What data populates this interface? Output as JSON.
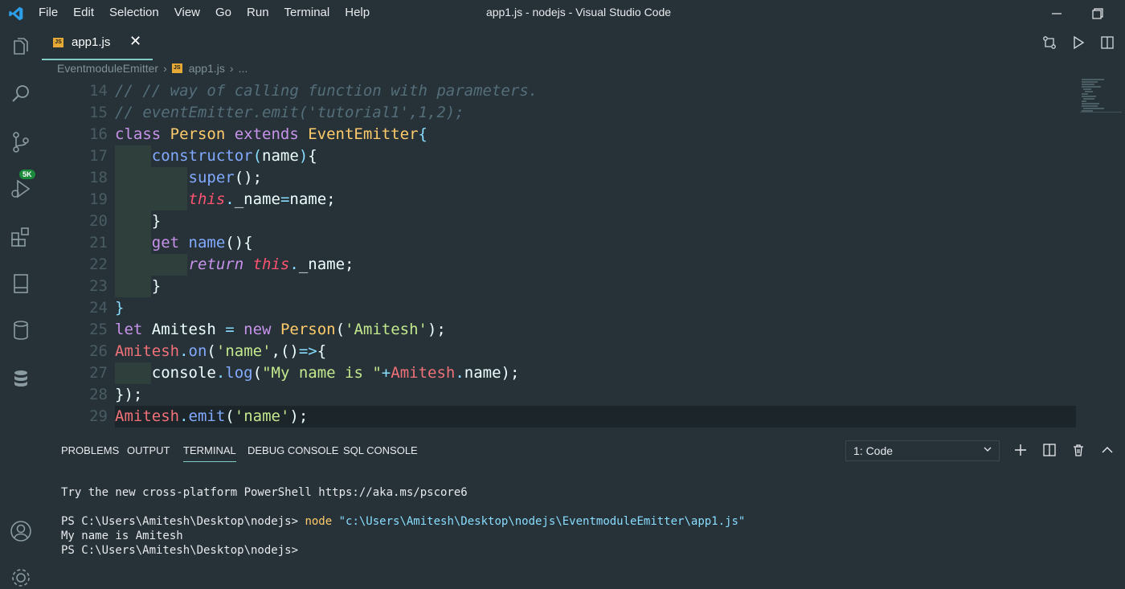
{
  "app": {
    "window_title": "app1.js - nodejs - Visual Studio Code",
    "menu": [
      "File",
      "Edit",
      "Selection",
      "View",
      "Go",
      "Run",
      "Terminal",
      "Help"
    ]
  },
  "activity_bar": {
    "source_control_badge": "5K",
    "icons": [
      "explorer-icon",
      "search-icon",
      "source-control-icon",
      "run-debug-icon",
      "extensions-icon",
      "remote-explorer-icon",
      "database-icon",
      "sql-icon",
      "account-icon",
      "settings-gear-icon"
    ]
  },
  "tab": {
    "label": "app1.js",
    "file_badge": "JS",
    "close": "✕"
  },
  "breadcrumb": {
    "folder": "EventmoduleEmitter",
    "file": "app1.js",
    "more": "..."
  },
  "code": {
    "lines": [
      {
        "n": "14",
        "segs": [
          [
            "comment",
            "// // way of calling function with parameters."
          ]
        ]
      },
      {
        "n": "15",
        "segs": [
          [
            "comment",
            "// eventEmitter.emit('tutorial1',1,2);"
          ]
        ]
      },
      {
        "n": "16",
        "segs": [
          [
            "kw-purple",
            "class "
          ],
          [
            "kw-yellow",
            "Person "
          ],
          [
            "kw-purple",
            "extends "
          ],
          [
            "kw-yellow",
            "EventEmitter"
          ],
          [
            "cyan",
            "{"
          ]
        ]
      },
      {
        "n": "17",
        "segs": [
          [
            "blue",
            "    constructor"
          ],
          [
            "cyan",
            "("
          ],
          [
            "white",
            "name"
          ],
          [
            "cyan",
            ")"
          ],
          [
            "white",
            "{"
          ]
        ]
      },
      {
        "n": "18",
        "segs": [
          [
            "blue",
            "        super"
          ],
          [
            "white",
            "();"
          ]
        ]
      },
      {
        "n": "19",
        "segs": [
          [
            "this",
            "        this"
          ],
          [
            "cyan",
            "."
          ],
          [
            "white",
            "_name"
          ],
          [
            "cyan",
            "="
          ],
          [
            "white",
            "name;"
          ]
        ]
      },
      {
        "n": "20",
        "segs": [
          [
            "white",
            "    }"
          ]
        ]
      },
      {
        "n": "21",
        "segs": [
          [
            "kw-purple",
            "    get "
          ],
          [
            "blue",
            "name"
          ],
          [
            "white",
            "(){"
          ]
        ]
      },
      {
        "n": "22",
        "segs": [
          [
            "italic-purple",
            "        return "
          ],
          [
            "this",
            "this"
          ],
          [
            "cyan",
            "."
          ],
          [
            "white",
            "_name;"
          ]
        ]
      },
      {
        "n": "23",
        "segs": [
          [
            "white",
            "    }"
          ]
        ]
      },
      {
        "n": "24",
        "segs": [
          [
            "cyan",
            "}"
          ]
        ]
      },
      {
        "n": "25",
        "segs": [
          [
            "kw-purple",
            "let "
          ],
          [
            "white",
            "Amitesh "
          ],
          [
            "cyan",
            "= "
          ],
          [
            "kw-purple",
            "new "
          ],
          [
            "kw-yellow",
            "Person"
          ],
          [
            "white",
            "("
          ],
          [
            "green",
            "'Amitesh'"
          ],
          [
            "white",
            ");"
          ]
        ]
      },
      {
        "n": "26",
        "segs": [
          [
            "ident-red",
            "Amitesh"
          ],
          [
            "cyan",
            "."
          ],
          [
            "blue",
            "on"
          ],
          [
            "white",
            "("
          ],
          [
            "green",
            "'name'"
          ],
          [
            "white",
            ",()"
          ],
          [
            "cyan",
            "=>"
          ],
          [
            "white",
            "{"
          ]
        ]
      },
      {
        "n": "27",
        "segs": [
          [
            "white",
            "    console"
          ],
          [
            "cyan",
            "."
          ],
          [
            "blue",
            "log"
          ],
          [
            "white",
            "("
          ],
          [
            "green",
            "\"My name is \""
          ],
          [
            "cyan",
            "+"
          ],
          [
            "ident-red",
            "Amitesh"
          ],
          [
            "cyan",
            "."
          ],
          [
            "white",
            "name);"
          ]
        ]
      },
      {
        "n": "28",
        "segs": [
          [
            "white",
            "});"
          ]
        ]
      },
      {
        "n": "29",
        "segs": [
          [
            "ident-red",
            "Amitesh"
          ],
          [
            "cyan",
            "."
          ],
          [
            "blue",
            "emit"
          ],
          [
            "white",
            "("
          ],
          [
            "green",
            "'name'"
          ],
          [
            "white",
            ");"
          ]
        ]
      }
    ],
    "current_line": "29"
  },
  "panel": {
    "tabs": [
      "PROBLEMS",
      "OUTPUT",
      "TERMINAL",
      "DEBUG CONSOLE",
      "SQL CONSOLE"
    ],
    "active_tab": "TERMINAL",
    "terminal_select": "1: Code"
  },
  "terminal": {
    "line1": "Try the new cross-platform PowerShell https://aka.ms/pscore6",
    "prompt1": "PS C:\\Users\\Amitesh\\Desktop\\nodejs> ",
    "cmd": "node",
    "cmd_arg": "\"c:\\Users\\Amitesh\\Desktop\\nodejs\\EventmoduleEmitter\\app1.js\"",
    "output": "My name is Amitesh",
    "prompt2": "PS C:\\Users\\Amitesh\\Desktop\\nodejs>"
  },
  "colors": {
    "background": "#263238",
    "accent": "#80cbc4",
    "keyword": "#c792ea",
    "class_name": "#ffcb6b",
    "string": "#c3e88d",
    "function": "#82aaff",
    "comment": "#546e7a"
  }
}
